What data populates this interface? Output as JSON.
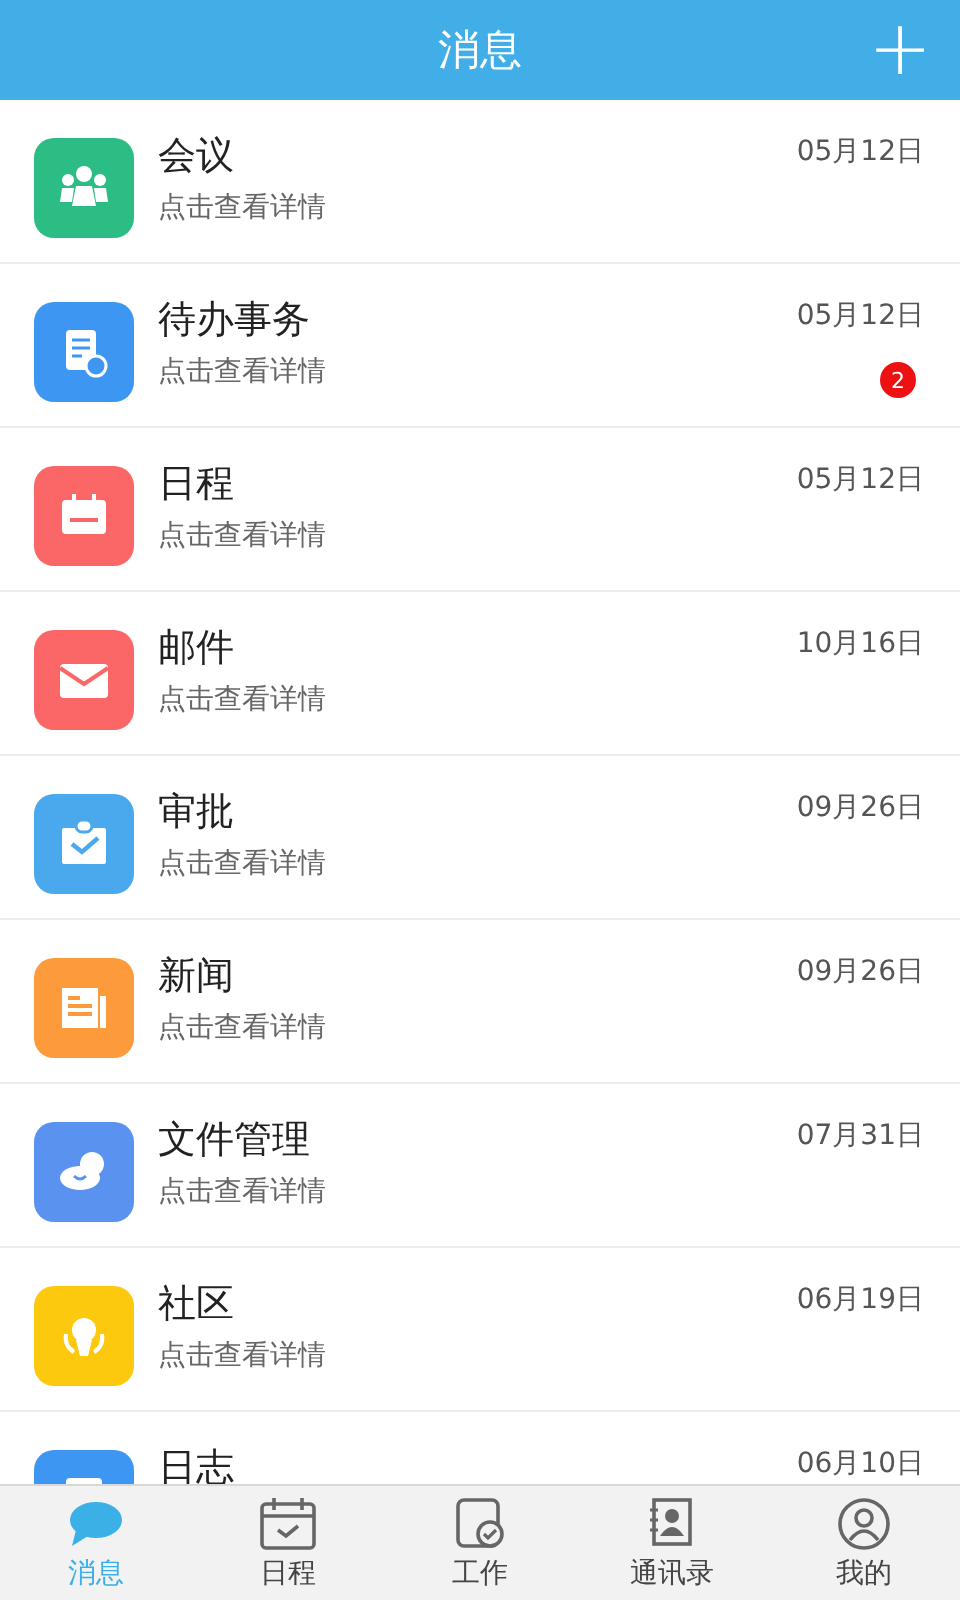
{
  "header": {
    "title": "消息",
    "add_button": "+"
  },
  "messages": [
    {
      "color": "#2bbd83",
      "title": "会议",
      "subtitle": "点击查看详情",
      "date": "05月12日"
    },
    {
      "color": "#3d97f2",
      "title": "待办事务",
      "subtitle": "点击查看详情",
      "date": "05月12日",
      "badge": "2"
    },
    {
      "color": "#fb6767",
      "title": "日程",
      "subtitle": "点击查看详情",
      "date": "05月12日"
    },
    {
      "color": "#fb6767",
      "title": "邮件",
      "subtitle": "点击查看详情",
      "date": "10月16日"
    },
    {
      "color": "#4aa8ec",
      "title": "审批",
      "subtitle": "点击查看详情",
      "date": "09月26日"
    },
    {
      "color": "#fd9a3c",
      "title": "新闻",
      "subtitle": "点击查看详情",
      "date": "09月26日"
    },
    {
      "color": "#5a92ef",
      "title": "文件管理",
      "subtitle": "点击查看详情",
      "date": "07月31日"
    },
    {
      "color": "#fdc90f",
      "title": "社区",
      "subtitle": "点击查看详情",
      "date": "06月19日"
    },
    {
      "color": "#3d97f2",
      "title": "日志",
      "date": "06月10日"
    }
  ],
  "tabs": [
    {
      "label": "消息",
      "selected": true
    },
    {
      "label": "日程",
      "selected": false
    },
    {
      "label": "工作",
      "selected": false
    },
    {
      "label": "通讯录",
      "selected": false
    },
    {
      "label": "我的",
      "selected": false
    }
  ]
}
